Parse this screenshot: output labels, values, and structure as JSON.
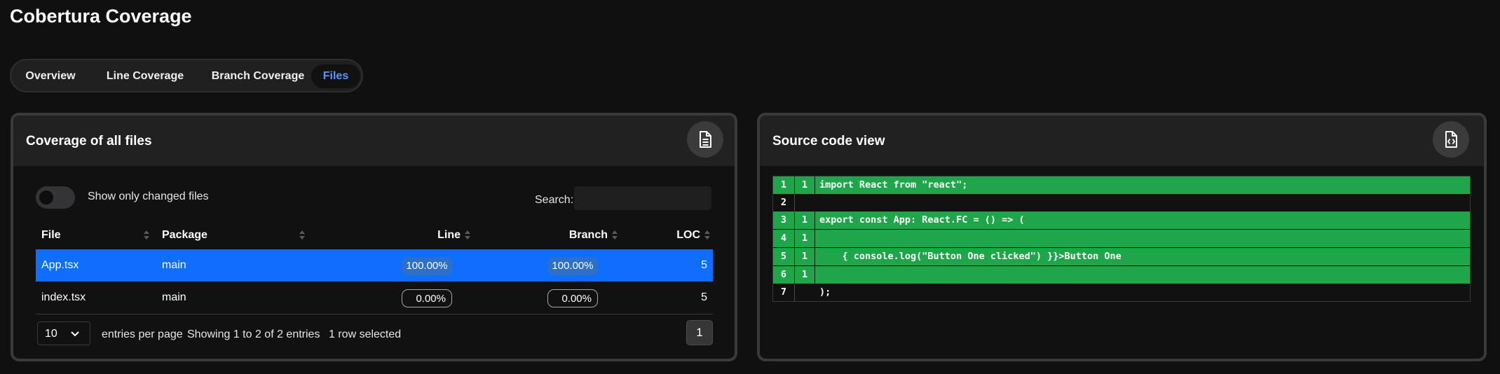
{
  "page": {
    "title": "Cobertura Coverage"
  },
  "tabs": [
    {
      "label": "Overview",
      "active": false
    },
    {
      "label": "Line Coverage",
      "active": false
    },
    {
      "label": "Branch Coverage",
      "active": false
    },
    {
      "label": "Files",
      "active": true
    }
  ],
  "files_card": {
    "title": "Coverage of all files",
    "icon": "file-text-icon",
    "toggle_label": "Show only changed files",
    "toggle_on": false,
    "search_label": "Search:",
    "search_value": "",
    "columns": [
      "File",
      "Package",
      "Line",
      "Branch",
      "LOC"
    ],
    "rows": [
      {
        "file": "App.tsx",
        "package": "main",
        "line": "100.00%",
        "branch": "100.00%",
        "loc": "5",
        "selected": true
      },
      {
        "file": "index.tsx",
        "package": "main",
        "line": "0.00%",
        "branch": "0.00%",
        "loc": "5",
        "selected": false
      }
    ],
    "entries_value": "10",
    "entries_label": "entries per page",
    "showing_text": "Showing 1 to 2 of 2 entries",
    "selected_text": "1 row selected",
    "page": "1"
  },
  "source_card": {
    "title": "Source code view",
    "icon": "file-code-icon",
    "lines": [
      {
        "n": "1",
        "hits": "1",
        "code": "import React from \"react\";",
        "covered": true
      },
      {
        "n": "2",
        "hits": "",
        "code": "",
        "covered": false
      },
      {
        "n": "3",
        "hits": "1",
        "code": "export const App: React.FC = () => (",
        "covered": true
      },
      {
        "n": "4",
        "hits": "1",
        "code": "",
        "covered": true
      },
      {
        "n": "5",
        "hits": "1",
        "code": "    { console.log(\"Button One clicked\") }}>Button One",
        "covered": true
      },
      {
        "n": "6",
        "hits": "1",
        "code": "",
        "covered": true
      },
      {
        "n": "7",
        "hits": "",
        "code": ");",
        "covered": false
      }
    ]
  },
  "colors": {
    "accent": "#0f6efd",
    "covered": "#1fa64a",
    "active_tab": "#5b95ff",
    "background": "#101010"
  }
}
